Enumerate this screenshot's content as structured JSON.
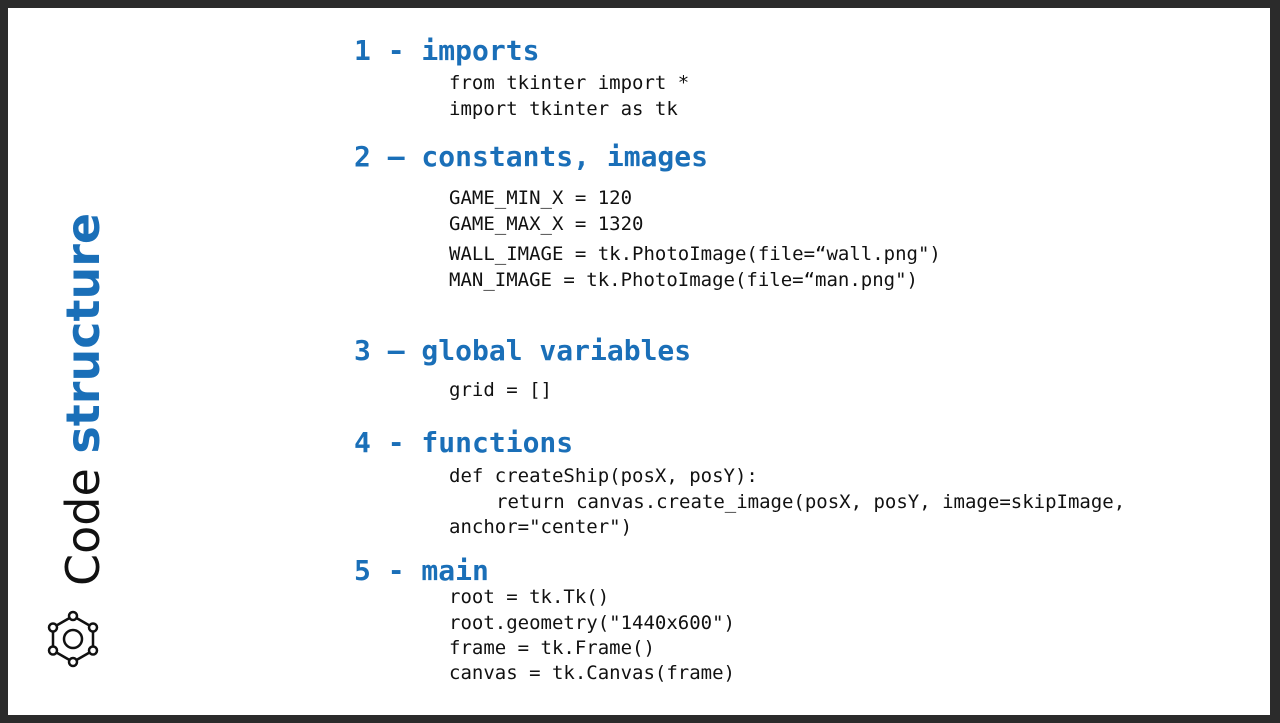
{
  "side_title": {
    "word1": "Code",
    "word2": "structure"
  },
  "sections": [
    {
      "title": "1 - imports",
      "lines": [
        "from tkinter import *",
        "import tkinter as tk"
      ]
    },
    {
      "title": "2 – constants, images",
      "lines": [
        "GAME_MIN_X = 120",
        "GAME_MAX_X = 1320",
        "WALL_IMAGE = tk.PhotoImage(file=“wall.png\")",
        "MAN_IMAGE = tk.PhotoImage(file=“man.png\")"
      ]
    },
    {
      "title": "3 – global variables",
      "lines": [
        "grid = []"
      ]
    },
    {
      "title": "4 - functions",
      "lines": [
        "def createShip(posX, posY):",
        "return canvas.create_image(posX, posY, image=skipImage,",
        "anchor=\"center\")"
      ]
    },
    {
      "title": "5 - main",
      "lines": [
        "root = tk.Tk()",
        "root.geometry(\"1440x600\")",
        "frame = tk.Frame()",
        "canvas = tk.Canvas(frame)"
      ]
    }
  ],
  "icons": {
    "settings": "gear-icon"
  },
  "colors": {
    "accent": "#1a6fb8",
    "text": "#111111",
    "frame": "#2b2b2b"
  }
}
